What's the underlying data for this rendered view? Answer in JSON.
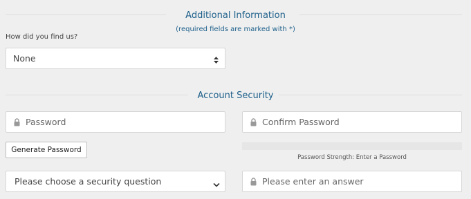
{
  "additional_info": {
    "title": "Additional Information",
    "subtitle": "(required fields are marked with *)",
    "find_us_label": "How did you find us?",
    "find_us_value": "None"
  },
  "account_security": {
    "title": "Account Security",
    "password_placeholder": "Password",
    "confirm_password_placeholder": "Confirm Password",
    "generate_button": "Generate Password",
    "strength_text": "Password Strength: Enter a Password",
    "strength_level": 0,
    "security_question_value": "Please choose a security question",
    "answer_placeholder": "Please enter an answer"
  },
  "icons": {
    "lock": "lock-icon",
    "select_arrows": "up-down-arrows-icon",
    "dropdown": "chevron-down-icon"
  },
  "colors": {
    "accent": "#1d5f8a",
    "background": "#efefef"
  }
}
